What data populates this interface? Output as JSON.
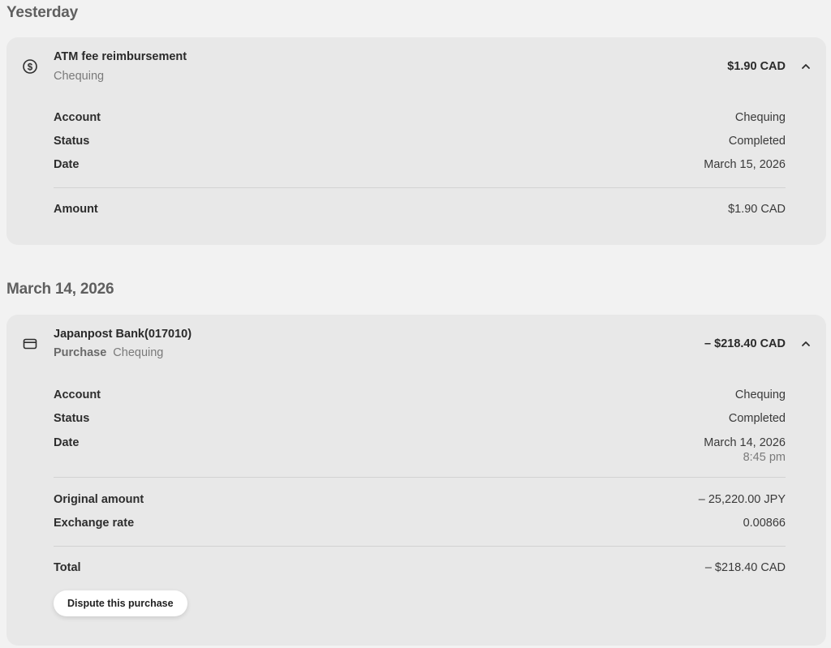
{
  "groups": [
    {
      "heading": "Yesterday",
      "transaction": {
        "icon": "dollar-circle-icon",
        "title": "ATM fee reimbursement",
        "subtitle_type": "",
        "subtitle_account": "Chequing",
        "amount": "$1.90 CAD",
        "expanded": true,
        "details": {
          "account_label": "Account",
          "account_value": "Chequing",
          "status_label": "Status",
          "status_value": "Completed",
          "date_label": "Date",
          "date_value": "March 15, 2026",
          "amount_label": "Amount",
          "amount_value": "$1.90 CAD"
        }
      }
    },
    {
      "heading": "March 14, 2026",
      "transaction": {
        "icon": "credit-card-icon",
        "title": "Japanpost Bank(017010)",
        "subtitle_type": "Purchase",
        "subtitle_account": "Chequing",
        "amount": "– $218.40 CAD",
        "expanded": true,
        "details": {
          "account_label": "Account",
          "account_value": "Chequing",
          "status_label": "Status",
          "status_value": "Completed",
          "date_label": "Date",
          "date_value": "March 14, 2026",
          "time_value": "8:45 pm",
          "original_amount_label": "Original amount",
          "original_amount_value": "– 25,220.00 JPY",
          "exchange_rate_label": "Exchange rate",
          "exchange_rate_value": "0.00866",
          "total_label": "Total",
          "total_value": "– $218.40 CAD",
          "dispute_button": "Dispute this purchase"
        }
      }
    }
  ]
}
